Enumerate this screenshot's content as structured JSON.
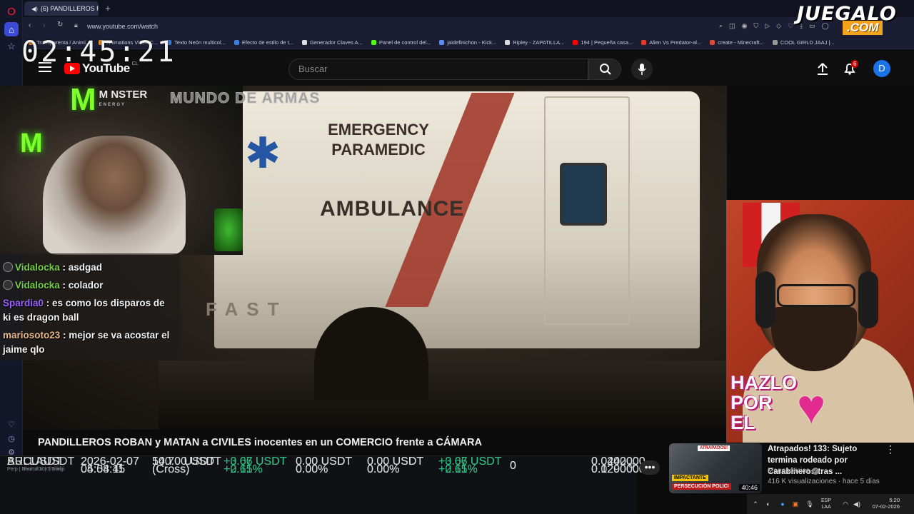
{
  "browser": {
    "tab_title": "(6) PANDILLEROS ROB",
    "url": "www.youtube.com/watch",
    "bookmarks": [
      {
        "label": "Transparenta / Animi...",
        "color": "#e58e26"
      },
      {
        "label": "Animations Video C...",
        "color": "#e58e26"
      },
      {
        "label": "Texto Neón multicol...",
        "color": "#3b7dd8"
      },
      {
        "label": "Efecto de estilo de t...",
        "color": "#3b7dd8"
      },
      {
        "label": "Generador Claves A...",
        "color": "#dddddd"
      },
      {
        "label": "Panel de control del...",
        "color": "#53fc18"
      },
      {
        "label": "jaidefinichon - Kick...",
        "color": "#5b8cff"
      },
      {
        "label": "Ripley - ZAPATILLA...",
        "color": "#dddddd"
      },
      {
        "label": "194 | Pequeña casa...",
        "color": "#ff0000"
      },
      {
        "label": "Alien Vs Predator-al...",
        "color": "#e03a2b"
      },
      {
        "label": "create - Minecraft...",
        "color": "#d94b3b"
      },
      {
        "label": "COOL GIRLD JAAJ |...",
        "color": "#999999"
      }
    ]
  },
  "overlay": {
    "clock": "02:45:21",
    "logo_top": "JUEGALO",
    "logo_bottom": ".COM",
    "monster": "M NSTER",
    "monster_sub": "ENERGY",
    "mundo": "MUNDO DE ARMAS",
    "hazlo": "HAZLO\nPOR\nEL"
  },
  "youtube": {
    "logo_text": "YouTube",
    "country": "CL",
    "search_placeholder": "Buscar",
    "notification_count": "6",
    "avatar_letter": "D",
    "video_title": "PANDILLEROS ROBAN y MATAN a CIVILES inocentes en un COMERCIO frente a CÁMARA",
    "video_text": {
      "label1": "EMERGENCY\nPARAMEDIC",
      "label2": "AMBULANCE",
      "fast": "FAST"
    },
    "recommended": {
      "title": "Atrapados! 133: Sujeto termina rodeado por Carabineros tras ...",
      "channel": "Meganoticias",
      "meta": "416 K visualizaciones · hace 5 días",
      "duration": "40:46",
      "badge_top": "ATRAPADOS!",
      "badge_a": "IMPACTANTE",
      "badge_b": "PERSECUCIÓN POLICI"
    }
  },
  "chat": [
    {
      "user": "Vidalocka",
      "msg": " : asdgad",
      "color": "green",
      "badge": true
    },
    {
      "user": "Vidalocka",
      "msg": " : colador",
      "color": "green",
      "badge": true
    },
    {
      "user": "Spardia0",
      "msg": " : es como los disparos de ki es dragon ball",
      "color": "purple",
      "badge": false
    },
    {
      "user": "mariosoto23",
      "msg": " : mejor se va acostar el jaime qlo",
      "color": "orange",
      "badge": false
    }
  ],
  "trades": [
    {
      "symbol": "ARCUSDT",
      "sub": "Perp | Short 10x | Trailing",
      "date": "2026-02-07",
      "time": "05:04:11",
      "size": "140.00 USDT",
      "margin": "(Cross)",
      "pnl": "+3.66 USDT",
      "pnl_pct": "+2.61%",
      "c1": "0.00 USDT",
      "c1p": "0.00%",
      "c2": "0.00 USDT",
      "c2p": "0.00%",
      "pnl2": "+3.66 USDT",
      "pnl2_pct": "+2.61%",
      "count": "0",
      "p1": "0.0400000",
      "p2": "0.1200000"
    },
    {
      "symbol": "BULLAUSDT",
      "sub": "Perp | Neutral 10x | Trailin",
      "date": "2026-02-07",
      "time": "04:58:45",
      "size": "50.70 USDT",
      "margin": "(Cross)",
      "pnl": "+0.07 USDT",
      "pnl_pct": "+0.15%",
      "c1": "0.00 USDT",
      "c1p": "0.00%",
      "c2": "0.00 USDT",
      "c2p": "0.00%",
      "pnl2": "+0.07 USDT",
      "pnl2_pct": "+0.15%",
      "count": "0",
      "p1": "0.0242000",
      "p2": "0.0290000"
    }
  ],
  "taskbar": {
    "lang1": "ESP",
    "lang2": "LAA",
    "time": "5:20",
    "date": "07-02-2026"
  },
  "colors": {
    "accent_green": "#2ebd85",
    "yt_red": "#ff0000",
    "chat_green": "#76d046",
    "chat_purple": "#9a63ff",
    "chat_orange": "#e8b98a"
  }
}
